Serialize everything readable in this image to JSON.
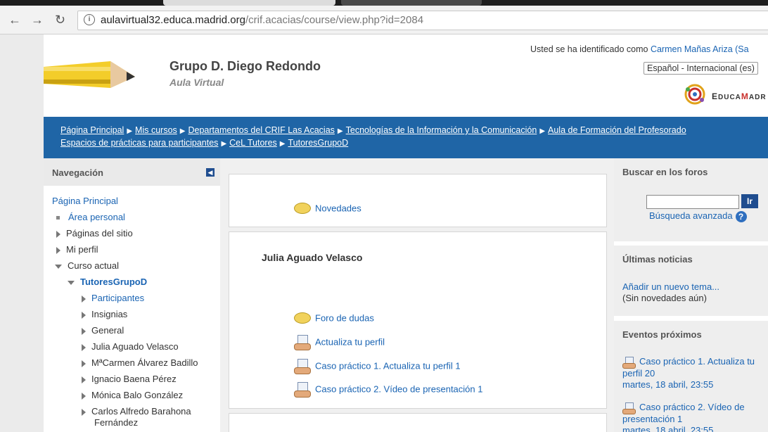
{
  "browser": {
    "url_host": "aulavirtual32.educa.madrid.org",
    "url_path": "/crif.acacias/course/view.php?id=2084"
  },
  "header": {
    "title": "Grupo D. Diego Redondo",
    "subtitle": "Aula Virtual",
    "login_prefix": "Usted se ha identificado como",
    "login_user": "Carmen Mañas Ariza (Sa",
    "language": "Español - Internacional (es)",
    "logo_text_prefix": "E",
    "logo_text_rest": "DUCA",
    "logo_text_red": "M",
    "logo_text_end": "ADR"
  },
  "breadcrumb": [
    "Página Principal",
    "Mis cursos",
    "Departamentos del CRIF Las Acacias",
    "Tecnologías de la Información y la Comunicación",
    "Aula de Formación del Profesorado",
    "Espacios de prácticas para participantes",
    "CeL Tutores",
    "TutoresGrupoD"
  ],
  "nav": {
    "title": "Navegación",
    "home": "Página Principal",
    "items": {
      "area_personal": "Área personal",
      "paginas_sitio": "Páginas del sitio",
      "mi_perfil": "Mi perfil",
      "curso_actual": "Curso actual",
      "course": "TutoresGrupoD",
      "participantes": "Participantes",
      "insignias": "Insignias",
      "general": "General",
      "julia": "Julia Aguado Velasco",
      "mcarmen": "MªCarmen Álvarez Badillo",
      "ignacio": "Ignacio Baena Pérez",
      "monica": "Mónica Balo González",
      "carlos_1": "Carlos Alfredo Barahona",
      "carlos_2": "Fernández"
    }
  },
  "content": {
    "section0": {
      "activity": "Novedades"
    },
    "section1": {
      "title": "Julia Aguado Velasco",
      "activities": [
        "Foro de dudas",
        "Actualiza tu perfil",
        "Caso práctico 1. Actualiza tu perfil 1",
        "Caso práctico 2. Vídeo de presentación 1"
      ]
    }
  },
  "right": {
    "search_title": "Buscar en los foros",
    "go_label": "Ir",
    "advanced": "Búsqueda avanzada",
    "news_title": "Últimas noticias",
    "news_add": "Añadir un nuevo tema...",
    "news_empty": "(Sin novedades aún)",
    "events_title": "Eventos próximos",
    "events": [
      {
        "title": "Caso práctico 1. Actualiza tu perfil 20",
        "date": "martes, 18 abril, 23:55"
      },
      {
        "title": "Caso práctico 2. Vídeo de presentación 1",
        "date": "martes, 18 abril, 23:55"
      }
    ]
  }
}
